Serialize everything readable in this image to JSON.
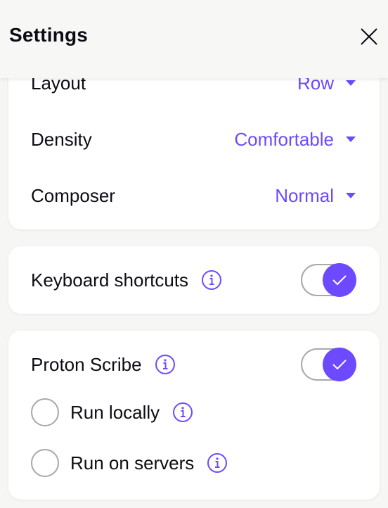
{
  "header": {
    "title": "Settings",
    "close_icon": "close-icon"
  },
  "appearance": {
    "rows": [
      {
        "label": "Layout",
        "value": "Row"
      },
      {
        "label": "Density",
        "value": "Comfortable"
      },
      {
        "label": "Composer",
        "value": "Normal"
      }
    ]
  },
  "keyboard_shortcuts": {
    "label": "Keyboard shortcuts",
    "enabled": true,
    "info_icon": "info-icon"
  },
  "proton_scribe": {
    "label": "Proton Scribe",
    "enabled": true,
    "info_icon": "info-icon",
    "options": [
      {
        "label": "Run locally",
        "selected": false
      },
      {
        "label": "Run on servers",
        "selected": false
      }
    ]
  },
  "colors": {
    "accent": "#6d4aff",
    "background": "#f6f6f4",
    "card": "#ffffff",
    "text": "#0c0c14",
    "border": "#a8a8a8"
  }
}
